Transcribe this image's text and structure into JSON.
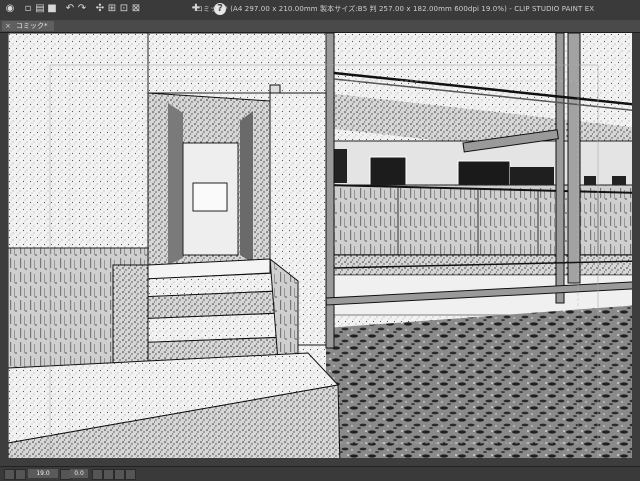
{
  "window": {
    "title": "コミック* (A4 297.00 x 210.00mm 製本サイズ:B5 判 257.00 x 182.00mm 600dpi 19.0%) - CLIP STUDIO PAINT EX"
  },
  "toolbar": {
    "icons": [
      "app-menu-icon",
      "new-icon",
      "open-icon",
      "save-icon",
      "undo-icon",
      "redo-icon",
      "snap-icon",
      "ruler-icon",
      "grid-icon",
      "perspective-icon",
      "transform-icon",
      "help-icon"
    ]
  },
  "tabs": [
    {
      "label": "コミック*",
      "close": "×"
    }
  ],
  "status": {
    "zoom": "19.0",
    "rotation": "0.0"
  }
}
